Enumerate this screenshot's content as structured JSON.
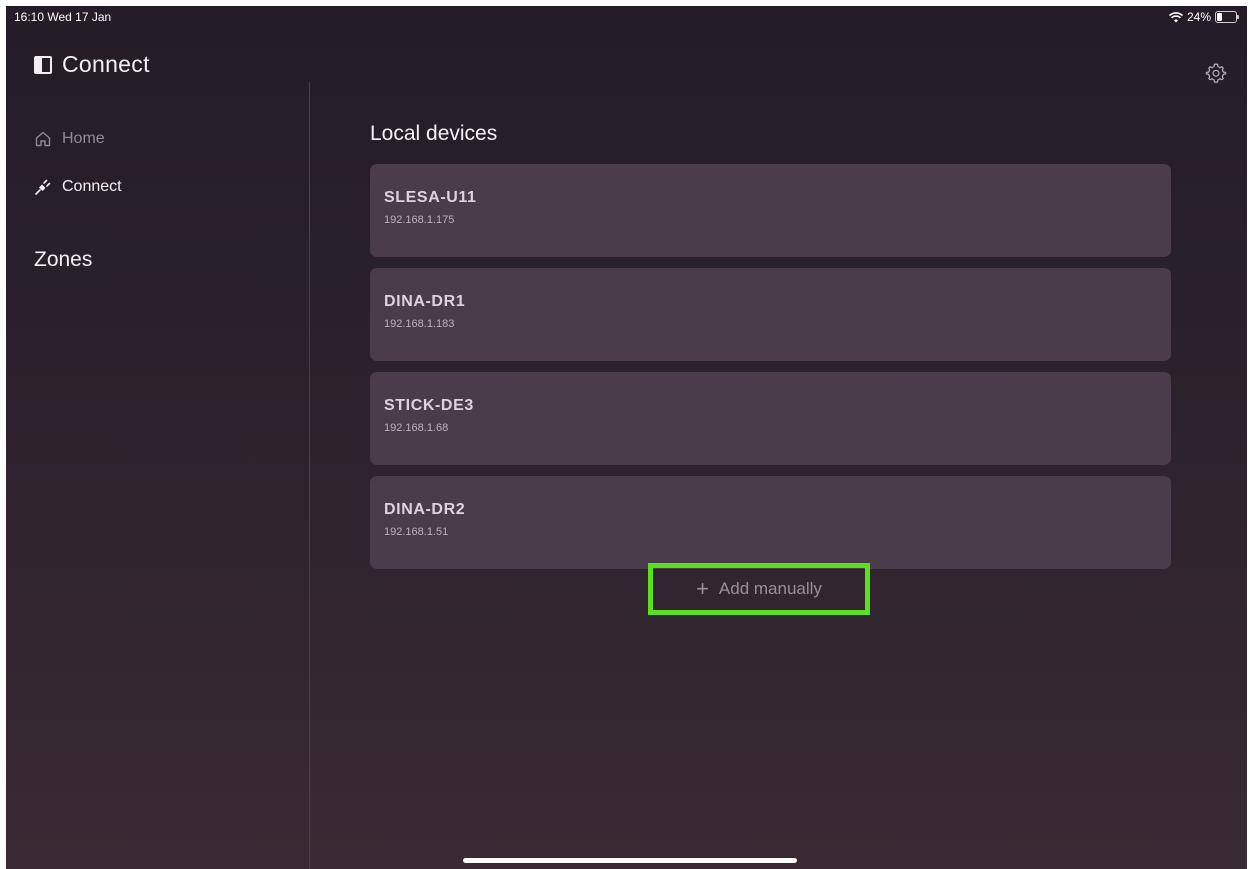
{
  "status_bar": {
    "time_date": "16:10  Wed 17 Jan",
    "battery_percent": "24%",
    "battery_level": 0.24
  },
  "header": {
    "title": "Connect"
  },
  "sidebar": {
    "items": [
      {
        "label": "Home",
        "icon": "home-icon"
      },
      {
        "label": "Connect",
        "icon": "plug-icon"
      }
    ],
    "zones_heading": "Zones"
  },
  "main": {
    "section_title": "Local devices",
    "devices": [
      {
        "name": "SLESA-U11",
        "ip": "192.168.1.175"
      },
      {
        "name": "DINA-DR1",
        "ip": "192.168.1.183"
      },
      {
        "name": "STICK-DE3",
        "ip": "192.168.1.68"
      },
      {
        "name": "DINA-DR2",
        "ip": "192.168.1.51"
      }
    ],
    "add_manually_label": "Add manually",
    "add_icon": "+"
  },
  "colors": {
    "highlight_border": "#5ae01d",
    "card_background": "#4a3c4b"
  }
}
